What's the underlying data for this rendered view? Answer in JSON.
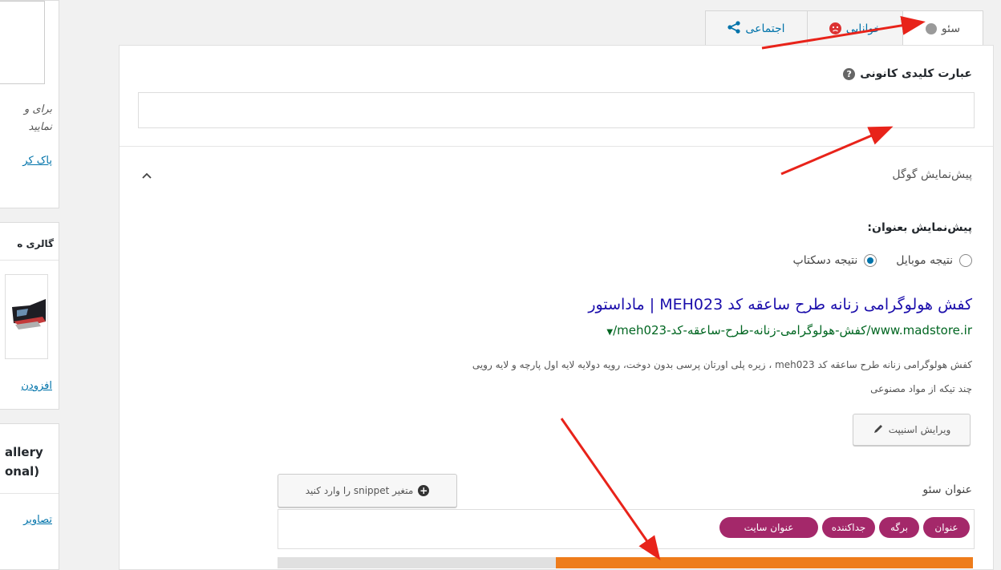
{
  "sidebar": {
    "box1": {
      "line1": "برای و",
      "line2": "نمایید",
      "link": "پاک کر"
    },
    "box2": {
      "heading": "گالری ه",
      "link": "افزودن"
    },
    "box3": {
      "line1": "allery",
      "line2": "onal)",
      "link": "تصاویر"
    }
  },
  "tabs": [
    {
      "label": "سئو",
      "icon": "status-dot-icon"
    },
    {
      "label": "خوانایی",
      "icon": "sad-face-icon"
    },
    {
      "label": "اجتماعی",
      "icon": "share-icon"
    }
  ],
  "focus_keyphrase": {
    "label": "عبارت کلیدی کانونی",
    "help": "?",
    "value": ""
  },
  "google_preview": {
    "section_title": "پیش‌نمایش گوگل",
    "preview_as_label": "پیش‌نمایش بعنوان:",
    "mobile_option": "نتیجه موبایل",
    "desktop_option": "نتیجه دسکتاپ",
    "selected": "desktop",
    "result_title": "کفش هولوگرامی زنانه طرح ساعقه کد MEH023 | ماداستور",
    "result_url": "www.madstore.ir/کفش-هولوگرامی-زنانه-طرح-ساعقه-کد-meh023/",
    "result_desc_line1": "کفش هولوگرامی زنانه طرح ساعقه کد meh023 ، زیره پلی اورتان پرسی بدون دوخت، رویه دولایه لایه اول پارچه و لایه رویی",
    "result_desc_line2": "چند تیکه از مواد مصنوعی",
    "edit_snippet_label": "ویرایش اسنیپت"
  },
  "seo_title": {
    "label": "عنوان سئو",
    "insert_variable_label": "متغیر snippet را وارد کنید",
    "pills": [
      "عنوان",
      "برگه",
      "جداکننده",
      "عنوان سایت"
    ]
  },
  "colors": {
    "accent": "#0073aa",
    "pill": "#a4286a",
    "progress": "#ee7c1b",
    "arrow": "#e8231a"
  },
  "progress": {
    "fill_fraction": 0.6
  }
}
